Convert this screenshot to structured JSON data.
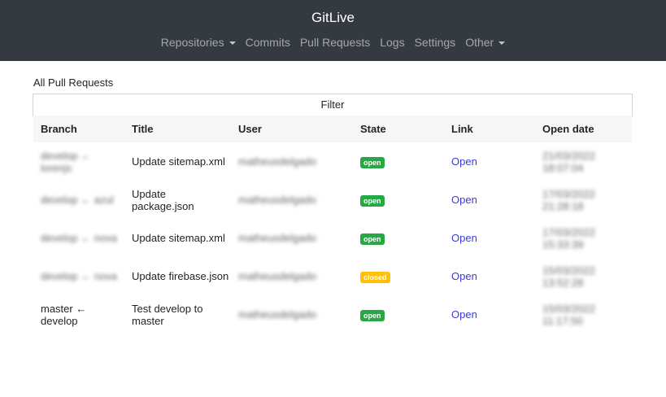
{
  "header": {
    "brand": "GitLive",
    "nav": [
      {
        "label": "Repositories",
        "dropdown": true
      },
      {
        "label": "Commits",
        "dropdown": false
      },
      {
        "label": "Pull Requests",
        "dropdown": false
      },
      {
        "label": "Logs",
        "dropdown": false
      },
      {
        "label": "Settings",
        "dropdown": false
      },
      {
        "label": "Other",
        "dropdown": true
      }
    ]
  },
  "page": {
    "title": "All Pull Requests",
    "filter_label": "Filter"
  },
  "table": {
    "headers": [
      "Branch",
      "Title",
      "User",
      "State",
      "Link",
      "Open date"
    ],
    "rows": [
      {
        "branch": "develop ← lorenjs",
        "title": "Update sitemap.xml",
        "user": "matheusdelgado",
        "state": "open",
        "link": "Open",
        "date": "21/03/2022 18:07:04",
        "branch_blur": true
      },
      {
        "branch": "develop ← azul",
        "title": "Update package.json",
        "user": "matheusdelgado",
        "state": "open",
        "link": "Open",
        "date": "17/03/2022 21:28:18",
        "branch_blur": true
      },
      {
        "branch": "develop ← nova",
        "title": "Update sitemap.xml",
        "user": "matheusdelgado",
        "state": "open",
        "link": "Open",
        "date": "17/03/2022 15:33:39",
        "branch_blur": true
      },
      {
        "branch": "develop ← nova",
        "title": "Update firebase.json",
        "user": "matheusdelgado",
        "state": "closed",
        "link": "Open",
        "date": "15/03/2022 13:52:28",
        "branch_blur": true
      },
      {
        "branch": "master ← develop",
        "title": "Test develop to master",
        "user": "matheusdelgado",
        "state": "open",
        "link": "Open",
        "date": "15/03/2022 11:17:50",
        "branch_blur": false
      }
    ]
  },
  "colors": {
    "navbar": "#343a40",
    "open_badge": "#28a745",
    "closed_badge": "#ffc107",
    "link": "#3b3bd6"
  }
}
